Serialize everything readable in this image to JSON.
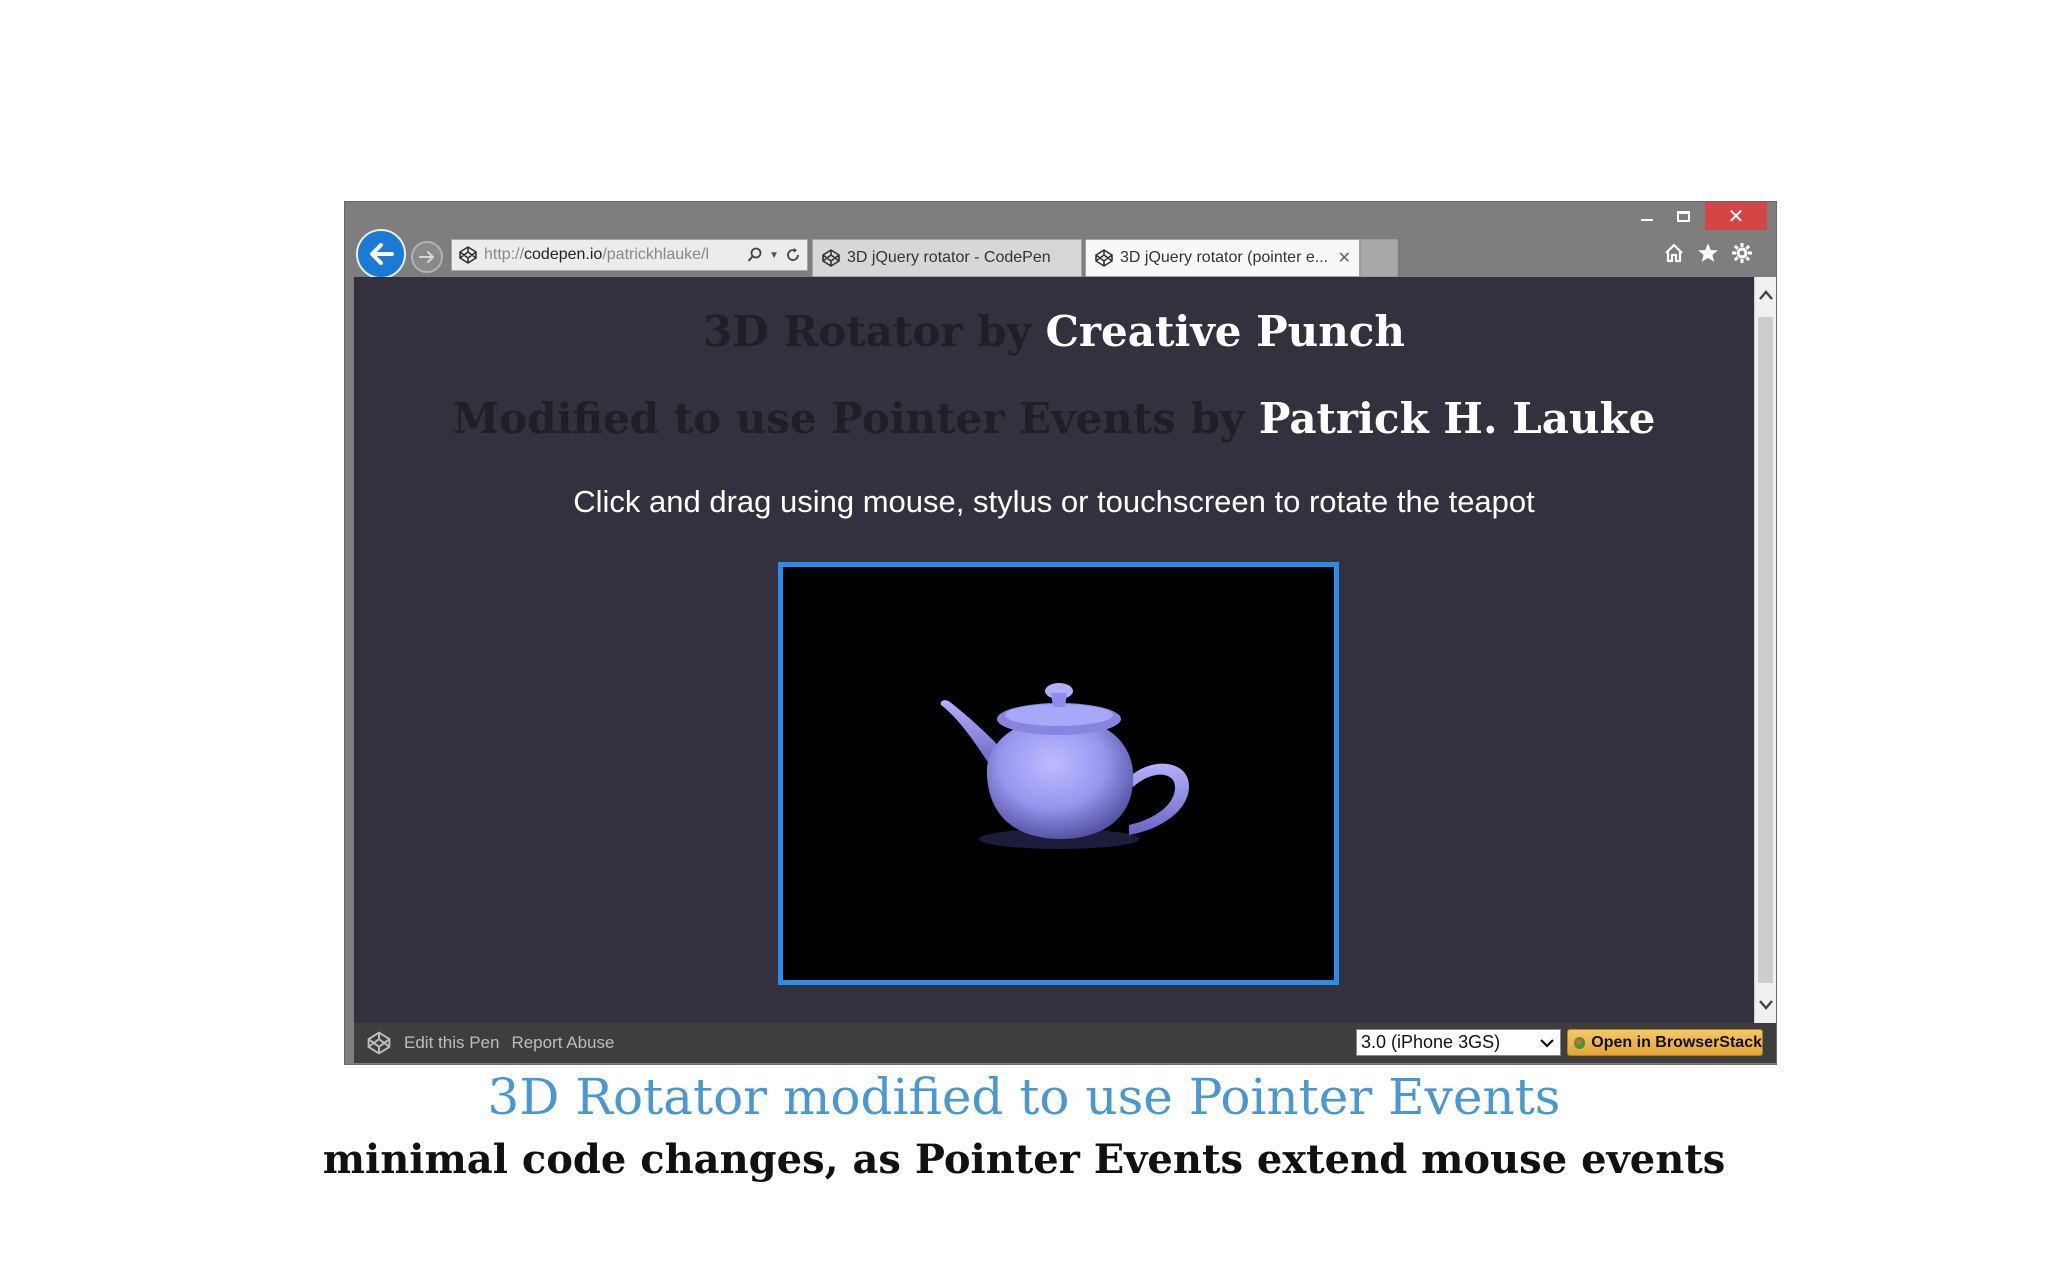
{
  "browser": {
    "address_prefix": "http://",
    "address_host": "codepen.io",
    "address_path": "/patrickhlauke/l",
    "tabs": [
      {
        "label": "3D jQuery rotator - CodePen",
        "active": false
      },
      {
        "label": "3D jQuery rotator (pointer e...",
        "active": true
      }
    ],
    "icons": [
      "back-arrow-icon",
      "forward-arrow-icon",
      "codepen-icon",
      "search-icon",
      "refresh-icon",
      "close-icon",
      "home-icon",
      "star-icon",
      "gear-icon"
    ],
    "window_controls": [
      "minimize",
      "maximize",
      "close"
    ]
  },
  "page": {
    "title_prefix": "3D Rotator by ",
    "title_name": "Creative Punch",
    "subtitle_prefix": "Modified to use Pointer Events by ",
    "subtitle_name": "Patrick H. Lauke",
    "instruction": "Click and drag using mouse, stylus or touchscreen to rotate the teapot"
  },
  "footer": {
    "edit_label": "Edit this Pen",
    "report_label": "Report Abuse",
    "device_selected": "3.0 (iPhone 3GS)",
    "browserstack_label": "Open in BrowserStack"
  },
  "slide": {
    "caption_title": "3D Rotator modified to use Pointer Events",
    "caption_subtitle": "minimal code changes, as Pointer Events extend mouse events"
  },
  "colors": {
    "page_bg": "#33313d",
    "canvas_border": "#2a8dea",
    "teapot": "#9a98f0",
    "caption_title": "#4a98d1",
    "close_button": "#d44646"
  }
}
